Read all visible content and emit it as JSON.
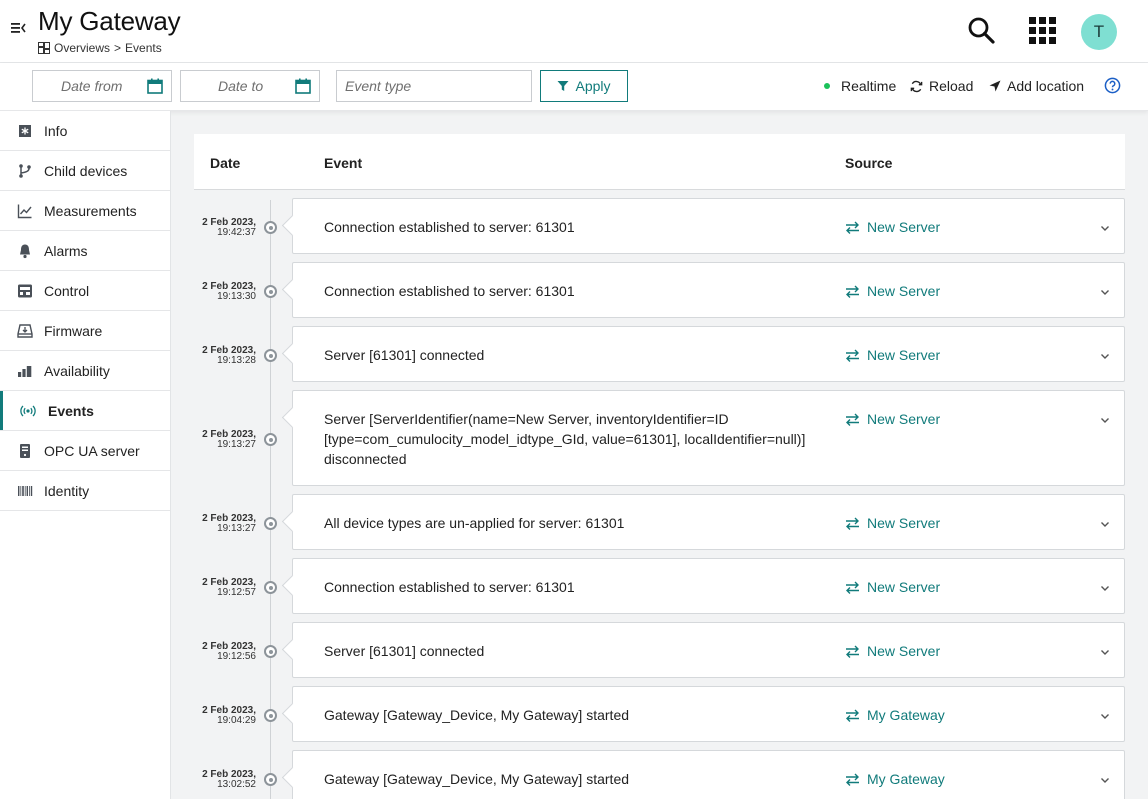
{
  "header": {
    "title": "My Gateway",
    "breadcrumb": [
      "Overviews",
      ">",
      "Events"
    ],
    "avatar_initial": "T"
  },
  "toolbar": {
    "date_from_placeholder": "Date from",
    "date_to_placeholder": "Date to",
    "event_type_placeholder": "Event type",
    "apply_label": "Apply",
    "realtime_label": "Realtime",
    "reload_label": "Reload",
    "add_location_label": "Add location"
  },
  "sidebar": {
    "items": [
      {
        "label": "Info",
        "icon": "info-icon"
      },
      {
        "label": "Child devices",
        "icon": "fork-icon"
      },
      {
        "label": "Measurements",
        "icon": "line-chart-icon"
      },
      {
        "label": "Alarms",
        "icon": "bell-icon"
      },
      {
        "label": "Control",
        "icon": "control-icon"
      },
      {
        "label": "Firmware",
        "icon": "firmware-icon"
      },
      {
        "label": "Availability",
        "icon": "bar-chart-icon"
      },
      {
        "label": "Events",
        "icon": "broadcast-icon",
        "active": true
      },
      {
        "label": "OPC UA server",
        "icon": "server-icon"
      },
      {
        "label": "Identity",
        "icon": "barcode-icon"
      }
    ]
  },
  "table": {
    "headers": {
      "date": "Date",
      "event": "Event",
      "source": "Source"
    },
    "rows": [
      {
        "date": "2 Feb 2023,",
        "time": "19:42:37",
        "event": "Connection established to server: 61301",
        "source": "New Server"
      },
      {
        "date": "2 Feb 2023,",
        "time": "19:13:30",
        "event": "Connection established to server: 61301",
        "source": "New Server"
      },
      {
        "date": "2 Feb 2023,",
        "time": "19:13:28",
        "event": "Server [61301] connected",
        "source": "New Server"
      },
      {
        "date": "2 Feb 2023,",
        "time": "19:13:27",
        "event": "Server [ServerIdentifier(name=New Server, inventoryIdentifier=ID [type=com_cumulocity_model_idtype_GId, value=61301], localIdentifier=null)] disconnected",
        "source": "New Server"
      },
      {
        "date": "2 Feb 2023,",
        "time": "19:13:27",
        "event": "All device types are un-applied for server: 61301",
        "source": "New Server"
      },
      {
        "date": "2 Feb 2023,",
        "time": "19:12:57",
        "event": "Connection established to server: 61301",
        "source": "New Server"
      },
      {
        "date": "2 Feb 2023,",
        "time": "19:12:56",
        "event": "Server [61301] connected",
        "source": "New Server"
      },
      {
        "date": "2 Feb 2023,",
        "time": "19:04:29",
        "event": "Gateway [Gateway_Device, My Gateway] started",
        "source": "My Gateway"
      },
      {
        "date": "2 Feb 2023,",
        "time": "13:02:52",
        "event": "Gateway [Gateway_Device, My Gateway] started",
        "source": "My Gateway"
      }
    ]
  },
  "colors": {
    "accent": "#117b7b",
    "realtime_dot": "#1bc15a",
    "avatar_bg": "#7fdfd2"
  }
}
